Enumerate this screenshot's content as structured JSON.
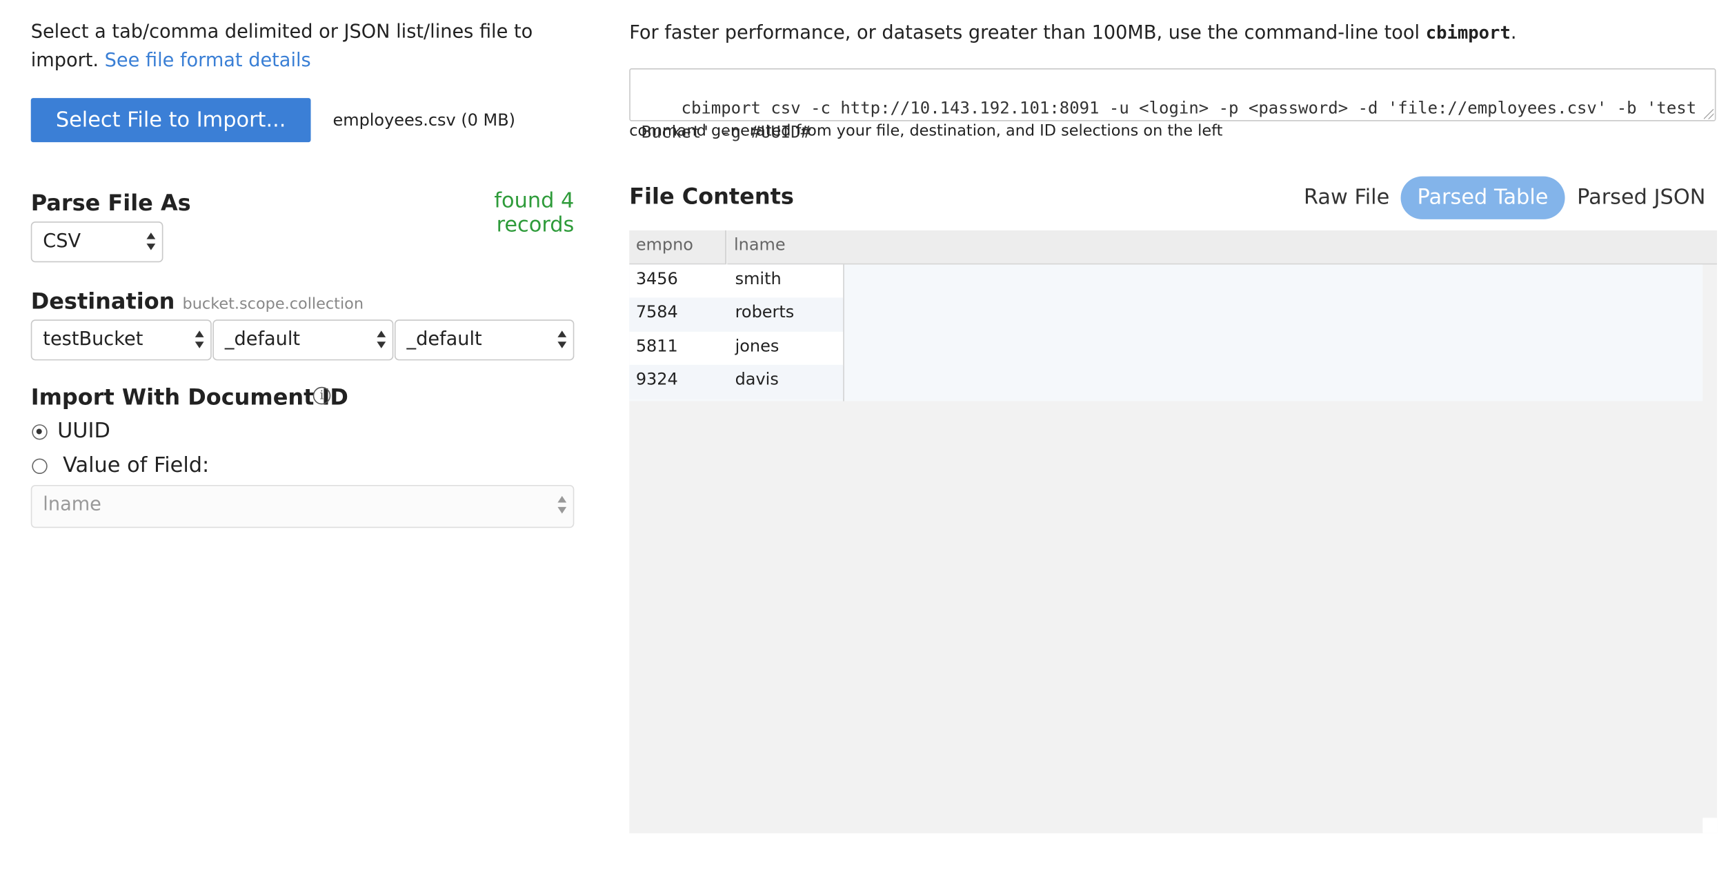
{
  "left": {
    "intro_text": "Select a tab/comma delimited or JSON list/lines file to import. ",
    "intro_link": "See file format details",
    "select_file_button": "Select File to Import...",
    "file_name": "employees.csv (0 MB)",
    "parse_title": "Parse File As",
    "found_records": "found 4 records",
    "parse_format": "CSV",
    "destination_title": "Destination",
    "destination_hint": "bucket.scope.collection",
    "destination": {
      "bucket": "testBucket",
      "scope": "_default",
      "collection": "_default"
    },
    "docid_title": "Import With Document ID",
    "docid_options": {
      "uuid": "UUID",
      "field": "Value of Field:"
    },
    "docid_selected": "UUID",
    "field_select": "lname"
  },
  "right": {
    "perf_text": "For faster performance, or datasets greater than 100MB, use the command-line tool ",
    "perf_tool": "cbimport",
    "perf_end": ".",
    "command": "cbimport csv -c http://10.143.192.101:8091 -u <login> -p <password> -d 'file://employees.csv' -b 'testBucket' -g #UUID#",
    "command_note": "command generated from your file, destination, and ID selections on the left",
    "file_contents_title": "File Contents",
    "tabs": [
      {
        "label": "Raw File",
        "active": false
      },
      {
        "label": "Parsed Table",
        "active": true
      },
      {
        "label": "Parsed JSON",
        "active": false
      }
    ],
    "table": {
      "columns": [
        "empno",
        "lname"
      ],
      "rows": [
        [
          "3456",
          "smith"
        ],
        [
          "7584",
          "roberts"
        ],
        [
          "5811",
          "jones"
        ],
        [
          "9324",
          "davis"
        ]
      ]
    }
  },
  "colors": {
    "primary_button": "#3b7fd6",
    "link": "#3a7fd5",
    "found_records": "#2e9b3a",
    "active_tab": "#83b4ea"
  }
}
